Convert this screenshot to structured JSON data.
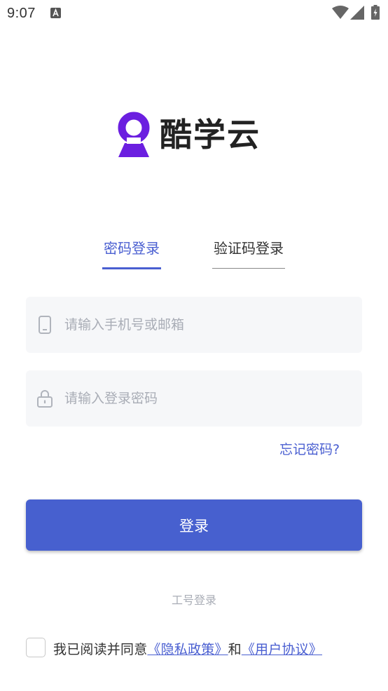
{
  "status_bar": {
    "time": "9:07",
    "icons": [
      "notification-a-icon",
      "wifi-icon",
      "cellular-signal-icon",
      "battery-charging-icon"
    ]
  },
  "app": {
    "logo_text": "酷学云",
    "logo_icon": "kuxueyun-logo-icon"
  },
  "tabs": [
    {
      "label": "密码登录",
      "active": true
    },
    {
      "label": "验证码登录",
      "active": false
    }
  ],
  "form": {
    "account_placeholder": "请输入手机号或邮箱",
    "account_value": "",
    "account_icon": "phone-icon",
    "password_placeholder": "请输入登录密码",
    "password_value": "",
    "password_icon": "lock-icon",
    "forgot_label": "忘记密码?",
    "login_label": "登录"
  },
  "alt_login": {
    "employee_label": "工号登录"
  },
  "agreement": {
    "checked": false,
    "prefix": "我已阅读并同意",
    "privacy_label": "《隐私政策》",
    "conjunction": "和",
    "terms_label": "《用户协议》"
  },
  "colors": {
    "accent": "#4a5fd1",
    "button": "#4760cf",
    "logo_purple": "#6b1fe0",
    "field_bg": "#f6f7f9",
    "placeholder": "#a9adb6"
  }
}
